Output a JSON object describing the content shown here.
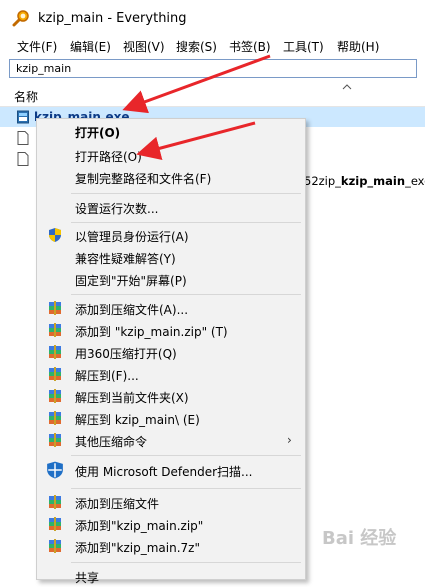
{
  "window": {
    "title": "kzip_main - Everything"
  },
  "menubar": {
    "items": [
      "文件(F)",
      "编辑(E)",
      "视图(V)",
      "搜索(S)",
      "书签(B)",
      "工具(T)",
      "帮助(H)"
    ]
  },
  "search": {
    "value": "kzip_main"
  },
  "columns": {
    "name_header": "名称"
  },
  "results": {
    "selected_name": "kzip_main.exe",
    "path_prefix": "52zip_",
    "path_bold": "kzip_main",
    "path_suffix": "_exe"
  },
  "context_menu": {
    "items": [
      {
        "label": "打开(O)",
        "icon": "none"
      },
      {
        "label": "打开路径(O)",
        "icon": "none"
      },
      {
        "label": "复制完整路径和文件名(F)",
        "icon": "none"
      },
      {
        "label": "设置运行次数...",
        "icon": "none"
      },
      {
        "label": "以管理员身份运行(A)",
        "icon": "uac-shield-icon"
      },
      {
        "label": "兼容性疑难解答(Y)",
        "icon": "none"
      },
      {
        "label": "固定到\"开始\"屏幕(P)",
        "icon": "none"
      },
      {
        "label": "添加到压缩文件(A)...",
        "icon": "archive-icon"
      },
      {
        "label": "添加到 \"kzip_main.zip\" (T)",
        "icon": "archive-icon"
      },
      {
        "label": "用360压缩打开(Q)",
        "icon": "archive-icon"
      },
      {
        "label": "解压到(F)...",
        "icon": "archive-icon"
      },
      {
        "label": "解压到当前文件夹(X)",
        "icon": "archive-icon"
      },
      {
        "label": "解压到 kzip_main\\ (E)",
        "icon": "archive-icon"
      },
      {
        "label": "其他压缩命令",
        "icon": "archive-icon"
      },
      {
        "label": "使用 Microsoft Defender扫描...",
        "icon": "defender-icon"
      },
      {
        "label": "添加到压缩文件",
        "icon": "archive-icon"
      },
      {
        "label": "添加到\"kzip_main.zip\"",
        "icon": "archive-icon"
      },
      {
        "label": "添加到\"kzip_main.7z\"",
        "icon": "archive-icon"
      },
      {
        "label": "共享",
        "icon": "share-icon"
      }
    ]
  },
  "watermark": {
    "text": "Bai 经验"
  },
  "colors": {
    "selection": "#cce8ff",
    "annotation_arrow": "#e8262a",
    "menu_bg": "#f2f2f2"
  }
}
